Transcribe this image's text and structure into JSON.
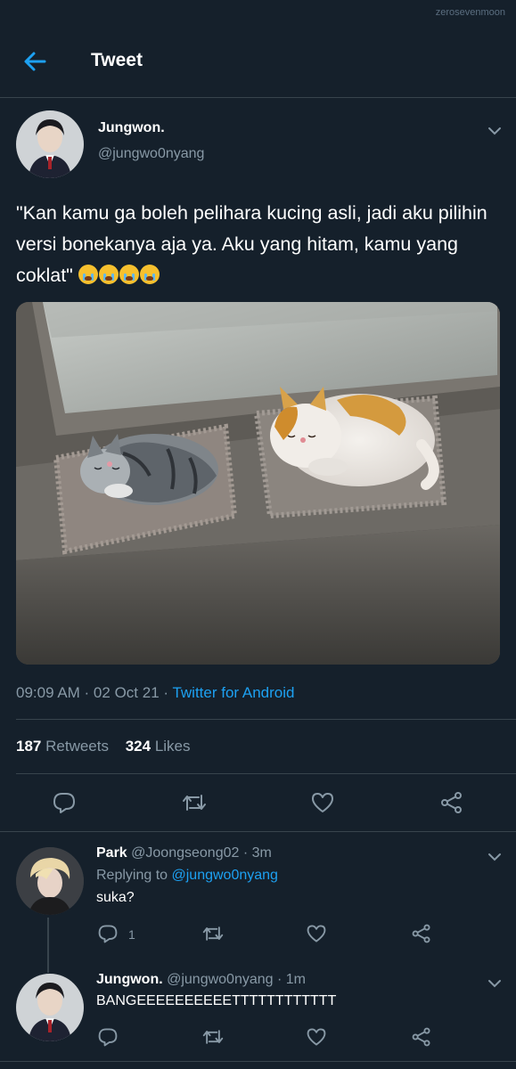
{
  "watermark": "zerosevenmoon",
  "header": {
    "title": "Tweet"
  },
  "tweet": {
    "author_name": "Jungwon.",
    "author_handle": "@jungwo0nyang",
    "text": "\"Kan kamu ga boleh pelihara kucing asli, jadi aku pilihin versi bonekanya aja ya. Aku yang hitam, kamu yang coklat\"",
    "emoji_count": 4,
    "image_icon": "photo-two-plush-cats-on-windowsill",
    "time": "09:09 AM · 02 Oct 21 · ",
    "source": "Twitter for Android",
    "retweets_count": "187",
    "retweets_label": "Retweets",
    "likes_count": "324",
    "likes_label": "Likes"
  },
  "replies": [
    {
      "name": "Park",
      "handle_time": "@Joongseong02 · 3m",
      "replying_prefix": "Replying to ",
      "replying_to": "@jungwo0nyang",
      "text": "suka?",
      "reply_count": "1"
    },
    {
      "name": "Jungwon.",
      "handle_time": "@jungwo0nyang · 1m",
      "text": "BANGEEEEEEEEEETTTTTTTTTTTT",
      "reply_count": ""
    }
  ],
  "colors": {
    "background": "#15202b",
    "accent": "#1da1f2",
    "muted": "#8899a6",
    "divider": "#38444d"
  }
}
